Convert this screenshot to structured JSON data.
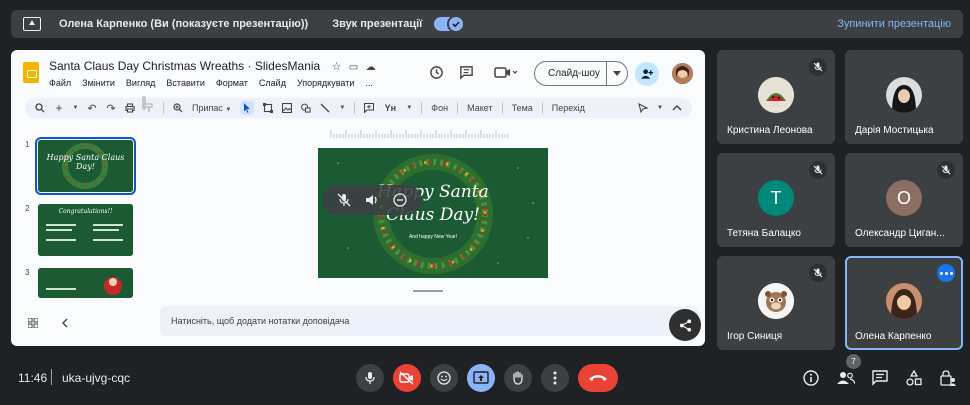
{
  "banner": {
    "presenter_text": "Олена Карпенко (Ви (показуєте презентацію))",
    "sound_label": "Звук презентації",
    "sound_on": true,
    "stop_label": "Зупинити презентацію"
  },
  "slides": {
    "doc_title": "Santa Claus Day Christmas Wreaths · SlidesMania",
    "menu": [
      "Файл",
      "Змінити",
      "Вигляд",
      "Вставити",
      "Формат",
      "Слайд",
      "Упорядкувати",
      "..."
    ],
    "slideshow_label": "Слайд-шоу",
    "toolbar": {
      "zoom_label": "Припас",
      "background_label": "Фон",
      "layout_label": "Макет",
      "theme_label": "Тема",
      "transition_label": "Перехід"
    },
    "thumbnails": [
      {
        "num": "1",
        "title": "Happy Santa Claus Day!"
      },
      {
        "num": "2",
        "title": "Congratulations!!"
      },
      {
        "num": "3",
        "title": ""
      }
    ],
    "current_slide": {
      "title_line1": "Happy Santa",
      "title_line2": "Claus Day!",
      "subtitle": "And happy New Year!"
    },
    "notes_placeholder": "Натисніть, щоб додати нотатки доповідача"
  },
  "participants": [
    {
      "name": "Кристина Леонова",
      "initial": "",
      "muted": true,
      "avatar_color": "#c7b79e"
    },
    {
      "name": "Дарія Мостицька",
      "initial": "",
      "muted": false,
      "avatar_color": "#2b2b2b"
    },
    {
      "name": "Тетяна Балацко",
      "initial": "T",
      "muted": true,
      "avatar_color": "#00897b"
    },
    {
      "name": "Олександр Циган...",
      "initial": "O",
      "muted": true,
      "avatar_color": "#8d6e63"
    },
    {
      "name": "Ігор Синиця",
      "initial": "",
      "muted": true,
      "avatar_color": "#f2f2f2"
    },
    {
      "name": "Олена Карпенко",
      "initial": "",
      "muted": false,
      "avatar_color": "#6b4a3a"
    }
  ],
  "bottom": {
    "time": "11:46",
    "meeting_code": "uka-ujvg-cqc",
    "people_count": "7"
  },
  "colors": {
    "accent": "#8ab4f8",
    "danger": "#ea4335",
    "slide_green": "#1e5a34"
  }
}
